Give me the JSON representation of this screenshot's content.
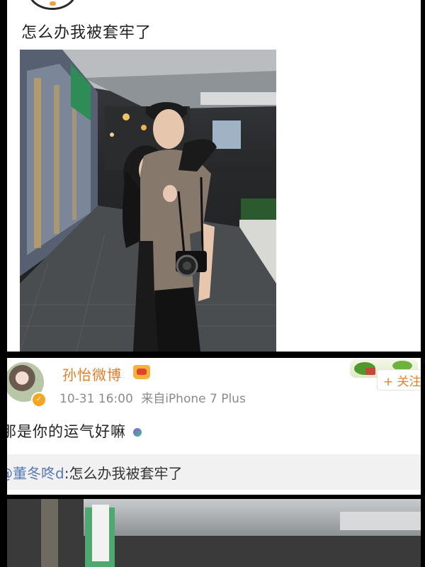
{
  "post_top": {
    "text": "怎么办我被套牢了"
  },
  "post_repost": {
    "username": "孙怡微博",
    "time": "10-31 16:00",
    "source": "来自iPhone 7 Plus",
    "follow_label": "+ 关注",
    "text": "那是你的运气好嘛",
    "quoted_mention": "@董冬咚d",
    "quoted_text": ":怎么办我被套牢了"
  },
  "colors": {
    "username": "#e27d26",
    "mention": "#5579b7",
    "meta": "#8a8a8a"
  },
  "icons": [
    "verified-badge-icon",
    "crown-icon",
    "candy-emoji-icon"
  ]
}
